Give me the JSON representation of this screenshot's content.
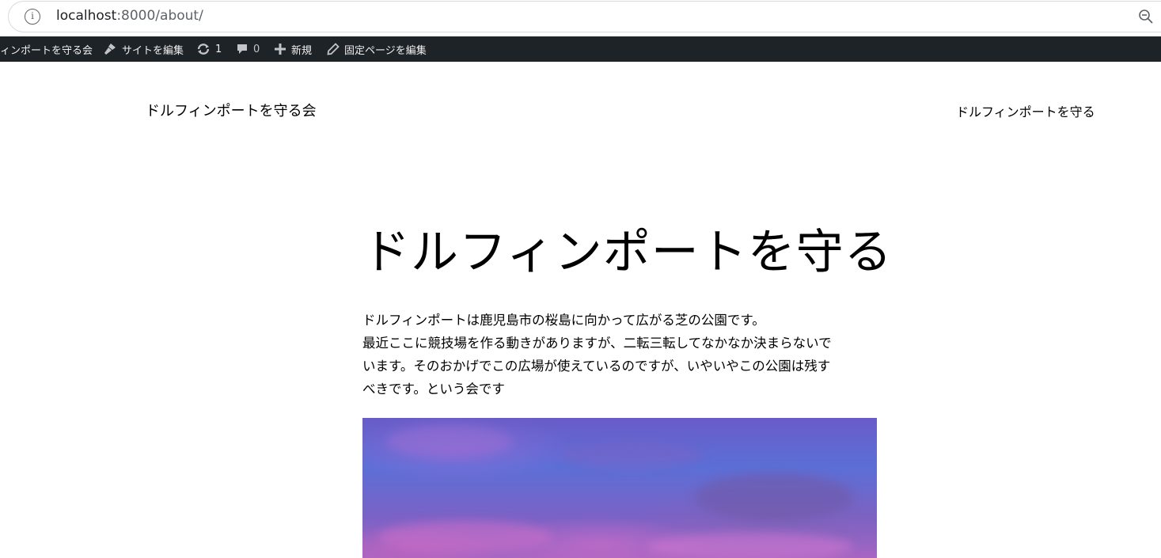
{
  "browser": {
    "url_host": "localhost",
    "url_path": ":8000/about/",
    "info_icon": "info-icon",
    "zoom_icon": "zoom-out-icon"
  },
  "admin_bar": {
    "site_name": "ィンポートを守る会",
    "edit_site": "サイトを編集",
    "updates_count": "1",
    "comments_count": "0",
    "new_label": "新規",
    "edit_page": "固定ページを編集",
    "background_color": "#1d2327"
  },
  "header": {
    "site_title": "ドルフィンポートを守る会",
    "nav_item": "ドルフィンポートを守る"
  },
  "main": {
    "page_title": "ドルフィンポートを守る",
    "paragraph_lines": [
      "ドルフィンポートは鹿児島市の桜島に向かって広がる芝の公園です。",
      "最近ここに競技場を作る動きがありますが、二転三転してなかなか決まらないで",
      "います。そのおかげでこの広場が使えているのですが、いやいやこの公園は残す",
      "べきです。という会です"
    ]
  }
}
